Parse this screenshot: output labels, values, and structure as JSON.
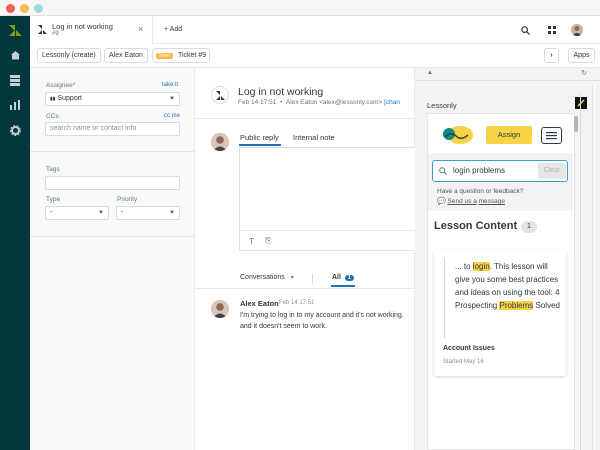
{
  "window": {
    "dots": [
      "#ee5f57",
      "#f4bd4f",
      "#9ed8d8"
    ]
  },
  "nav": {
    "items": [
      "logo-icon",
      "home-icon",
      "views-icon",
      "reporting-icon",
      "admin-icon"
    ]
  },
  "header": {
    "tab_title": "Log in not working",
    "tab_subtitle": "#9",
    "tab_close": "×",
    "add_label": "+ Add",
    "apps_label": "Apps"
  },
  "breadcrumb": {
    "org": "Lessonly (create)",
    "user": "Alex Eaton",
    "new_badge": "New",
    "ticket": "Ticket #9",
    "next": "›"
  },
  "props": {
    "assignee_label": "Assignee*",
    "take_it": "take it",
    "assignee_value": "Support",
    "ccs_label": "CCs",
    "cc_me": "cc me",
    "ccs_placeholder": "search name or contact info",
    "tags_label": "Tags",
    "type_label": "Type",
    "type_value": "-",
    "priority_label": "Priority",
    "priority_value": "-"
  },
  "ticket": {
    "subject": "Log in not working",
    "meta_date": "Feb 14 17:51",
    "meta_sep": "•",
    "meta_from": "Alex Eaton <alex@lessonly.com>",
    "meta_channel": "[chan",
    "public_reply": "Public reply",
    "internal_note": "Internal note",
    "conversations": "Conversations",
    "all_label": "All",
    "all_count": "1",
    "message_author": "Alex Eaton",
    "message_time": "Feb 14 17:51",
    "message_body": "I'm trying to log in to my account and it's not working. and it doesn't seem to work."
  },
  "app": {
    "title": "Lessonly",
    "assign_label": "Assign",
    "search_value": "login problems",
    "clear_label": "Clear",
    "feedback_q": "Have a question or feedback?",
    "send_us": "Send us a",
    "message_link": "message",
    "lesson_content": "Lesson Content",
    "lesson_count": "1",
    "snippet_pre": "... to",
    "snippet_hl1": "login",
    "snippet_mid": ". This lesson will give you some best practices and ideas on using the tool: 4 Prospecting",
    "snippet_hl2": "Problems",
    "snippet_post": "Solved",
    "result_title": "Account Issues",
    "result_date": "Started May 16"
  },
  "colors": {
    "nav": "#03363d",
    "accent": "#1f73b7",
    "highlight": "#f7d345",
    "teal": "#0c8a8a"
  }
}
